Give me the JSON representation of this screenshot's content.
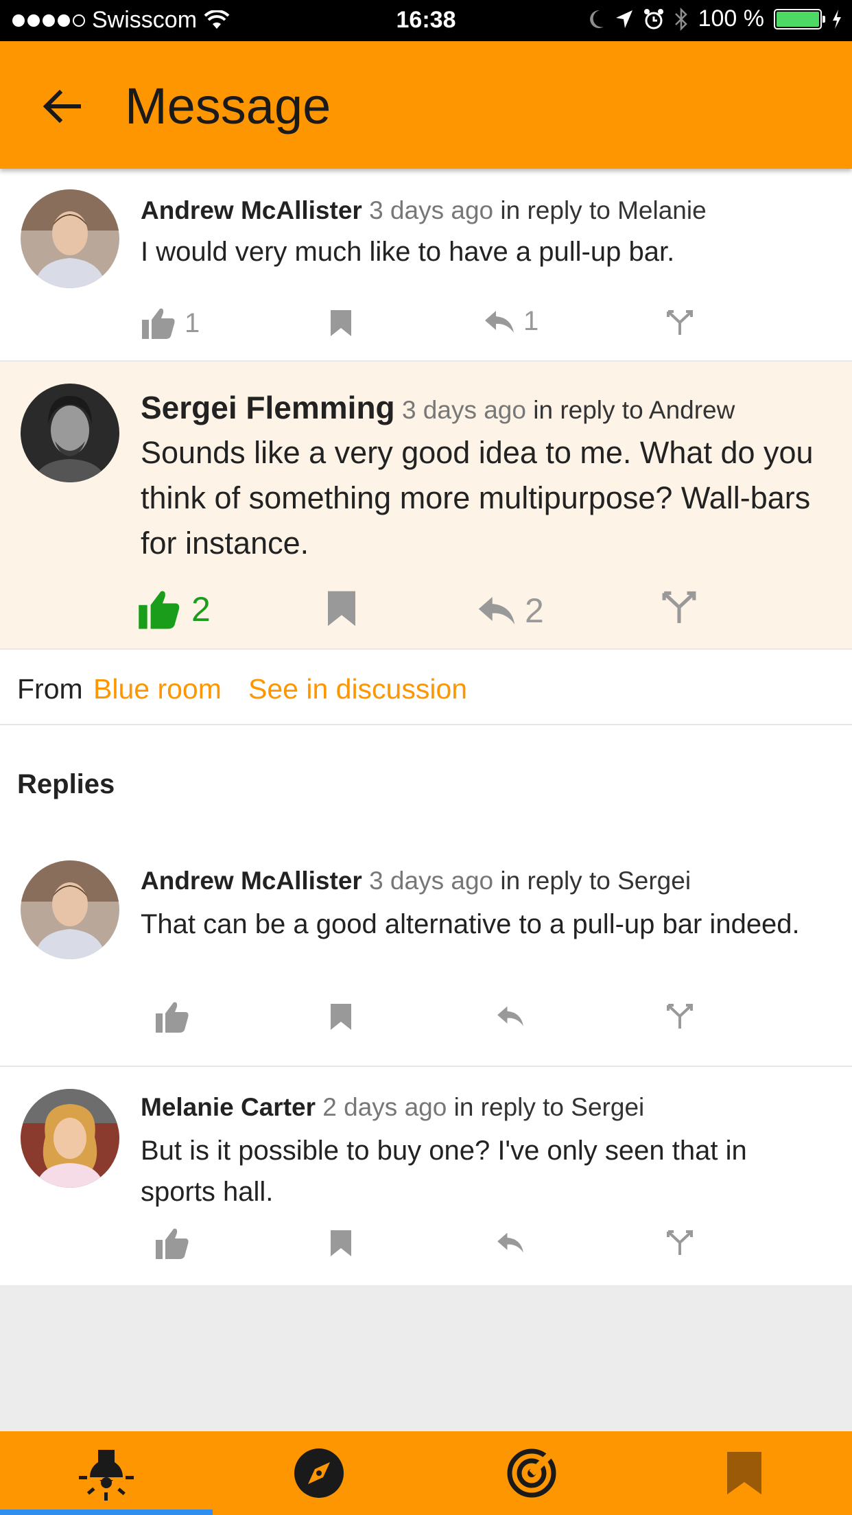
{
  "status_bar": {
    "carrier": "Swisscom",
    "time": "16:38",
    "battery": "100 %"
  },
  "app_bar": {
    "title": "Message"
  },
  "main_message": {
    "parent": {
      "author": "Andrew McAllister",
      "time_ago": "3 days ago",
      "reply_to": "in reply to Melanie",
      "text": "I would very much like to have a pull-up bar.",
      "likes": "1",
      "replies": "1"
    },
    "focused": {
      "author": "Sergei Flemming",
      "time_ago": "3 days ago",
      "reply_to": "in reply to Andrew",
      "text": "Sounds like a very good idea to me. What do you think of something more multipurpose? Wall-bars for instance.",
      "likes": "2",
      "replies": "2"
    }
  },
  "source": {
    "from_label": "From",
    "room": "Blue room",
    "discussion_link": "See in discussion"
  },
  "replies_section": {
    "header": "Replies",
    "items": [
      {
        "author": "Andrew McAllister",
        "time_ago": "3 days ago",
        "reply_to": "in reply to Sergei",
        "text": "That can be a good alternative to a pull-up bar indeed."
      },
      {
        "author": "Melanie Carter",
        "time_ago": "2 days ago",
        "reply_to": "in reply to Sergei",
        "text": "But is it possible to buy one? I've only seen that in sports hall."
      }
    ]
  },
  "bottom_nav": {
    "items": [
      "lamp-icon",
      "compass-icon",
      "radar-icon",
      "bookmark-icon"
    ],
    "active_index": 0
  },
  "colors": {
    "accent": "#fe9601",
    "liked_green": "#1a9d1a",
    "highlight_bg": "#fdf3e6",
    "nav_indicator": "#2e8ff0"
  }
}
